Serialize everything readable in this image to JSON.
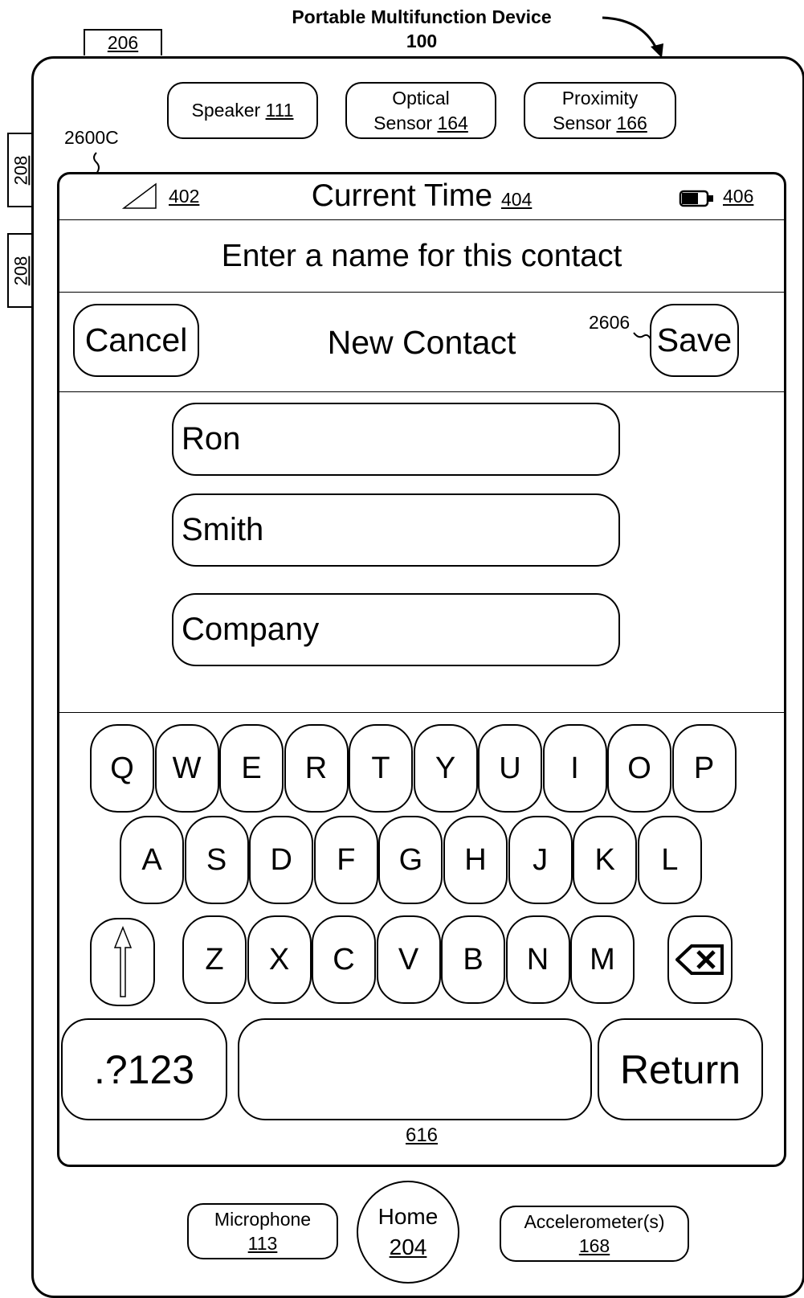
{
  "figure": {
    "title": "Portable Multifunction Device",
    "title_ref": "100",
    "ref_206": "206",
    "ref_208_a": "208",
    "ref_208_b": "208",
    "screen_ref": "2600C"
  },
  "hardware_top": {
    "speaker": {
      "label": "Speaker",
      "ref": "111"
    },
    "optical": {
      "line1": "Optical",
      "line2": "Sensor",
      "ref": "164"
    },
    "proximity": {
      "line1": "Proximity",
      "line2": "Sensor",
      "ref": "166"
    }
  },
  "status_bar": {
    "signal_ref": "402",
    "time_label": "Current Time",
    "time_ref": "404",
    "battery_ref": "406"
  },
  "prompt": "Enter a name for this contact",
  "nav": {
    "cancel": "Cancel",
    "title": "New Contact",
    "save": "Save",
    "save_ref": "2606"
  },
  "fields": {
    "first": "Ron",
    "last": "Smith",
    "company": "Company"
  },
  "keyboard": {
    "row1": [
      "Q",
      "W",
      "E",
      "R",
      "T",
      "Y",
      "U",
      "I",
      "O",
      "P"
    ],
    "row2": [
      "A",
      "S",
      "D",
      "F",
      "G",
      "H",
      "J",
      "K",
      "L"
    ],
    "row3": [
      "Z",
      "X",
      "C",
      "V",
      "B",
      "N",
      "M"
    ],
    "numbers_key": ".?123",
    "return_key": "Return",
    "ref": "616"
  },
  "hardware_bottom": {
    "microphone": {
      "label": "Microphone",
      "ref": "113"
    },
    "home": {
      "label": "Home",
      "ref": "204"
    },
    "accelerometer": {
      "label": "Accelerometer(s)",
      "ref": "168"
    }
  }
}
